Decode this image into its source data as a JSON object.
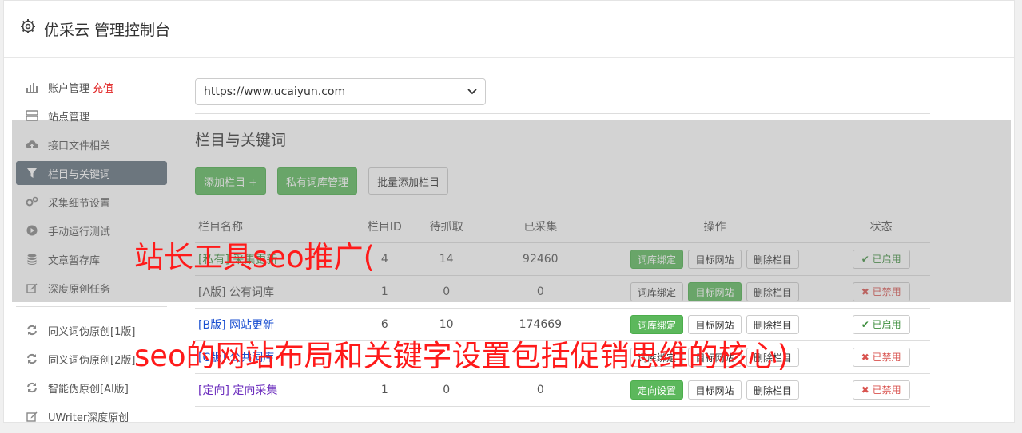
{
  "header": {
    "title": "优采云 管理控制台",
    "icon": "gear-icon"
  },
  "sidebar": {
    "items": [
      {
        "label": "账户管理",
        "extra": "充值",
        "icon": "bar-chart-icon"
      },
      {
        "label": "站点管理",
        "icon": "server-icon"
      },
      {
        "label": "接口文件相关",
        "icon": "cloud-upload-icon"
      },
      {
        "label": "栏目与关键词",
        "icon": "filter-icon",
        "active": true
      },
      {
        "label": "采集细节设置",
        "icon": "cogs-icon"
      },
      {
        "label": "手动运行测试",
        "icon": "play-circle-icon"
      },
      {
        "label": "文章暂存库",
        "icon": "database-icon"
      },
      {
        "label": "深度原创任务",
        "icon": "edit-icon"
      }
    ],
    "items2": [
      {
        "label": "同义词伪原创[1版]",
        "icon": "refresh-icon"
      },
      {
        "label": "同义词伪原创[2版]",
        "icon": "refresh-icon"
      },
      {
        "label": "智能伪原创[AI版]",
        "icon": "refresh-icon"
      },
      {
        "label": "UWriter深度原创",
        "icon": "edit-icon"
      }
    ]
  },
  "main": {
    "site_select": "https://www.ucaiyun.com",
    "section_title": "栏目与关键词",
    "buttons": {
      "add": "添加栏目 +",
      "private": "私有词库管理",
      "batch": "批量添加栏目"
    },
    "table": {
      "headers": [
        "栏目名称",
        "栏目ID",
        "待抓取",
        "已采集",
        "操作",
        "状态"
      ],
      "rows": [
        {
          "tag": "[私有]",
          "name": "采集更新",
          "id": "4",
          "pending": "14",
          "collected": "92460",
          "op1": "词库绑定",
          "op2": "目标网站",
          "op3": "删除栏目",
          "status": "已启用"
        },
        {
          "tag": "[A版]",
          "name": "公有词库",
          "id": "1",
          "pending": "0",
          "collected": "0",
          "op1": "词库绑定",
          "op2": "目标网站",
          "op3": "删除栏目",
          "status": "已禁用"
        },
        {
          "tag": "[B版]",
          "name": "网站更新",
          "id": "6",
          "pending": "10",
          "collected": "174669",
          "op1": "词库绑定",
          "op2": "目标网站",
          "op3": "删除栏目",
          "status": "已启用"
        },
        {
          "tag": "[C版]",
          "name": "公共词库",
          "id": "",
          "pending": "",
          "collected": "",
          "op1": "词库绑定",
          "op2": "目标网站",
          "op3": "删除栏目",
          "status": "已禁用"
        },
        {
          "tag": "[定向]",
          "name": "定向采集",
          "id": "1",
          "pending": "0",
          "collected": "0",
          "op1": "定向设置",
          "op2": "目标网站",
          "op3": "删除栏目",
          "status": "已禁用"
        }
      ]
    }
  },
  "watermark": {
    "line1": "站长工具seo推广(",
    "line2": "seo的网站布局和关键字设置包括促销思维的核心)"
  },
  "colors": {
    "accent": "#5cb85c",
    "active_nav": "#62707d",
    "watermark": "#ff1a1a"
  }
}
